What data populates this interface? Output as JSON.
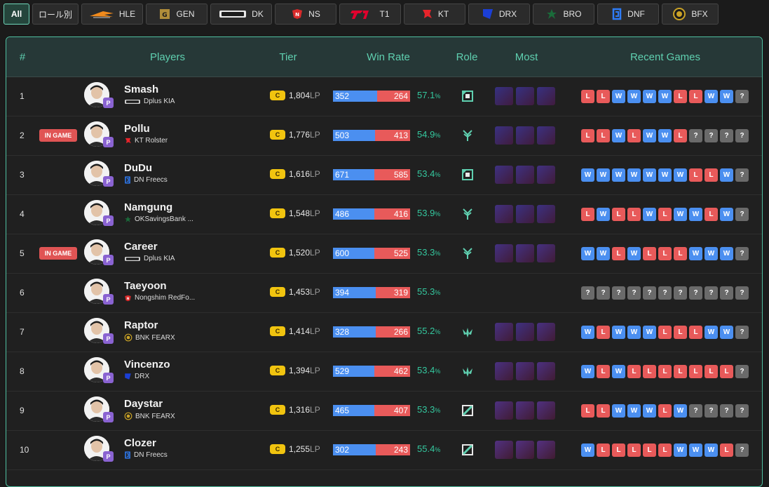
{
  "tabs": [
    {
      "label": "All",
      "logo": "",
      "active": true
    },
    {
      "label": "ロール別",
      "logo": "",
      "active": false
    },
    {
      "label": "HLE",
      "logo": "hle-logo",
      "active": false
    },
    {
      "label": "GEN",
      "logo": "gen-logo",
      "active": false
    },
    {
      "label": "DK",
      "logo": "dk-logo",
      "active": false
    },
    {
      "label": "NS",
      "logo": "ns-logo",
      "active": false
    },
    {
      "label": "T1",
      "logo": "t1-logo",
      "active": false
    },
    {
      "label": "KT",
      "logo": "kt-logo",
      "active": false
    },
    {
      "label": "DRX",
      "logo": "drx-logo",
      "active": false
    },
    {
      "label": "BRO",
      "logo": "bro-logo",
      "active": false
    },
    {
      "label": "DNF",
      "logo": "dnf-logo",
      "active": false
    },
    {
      "label": "BFX",
      "logo": "bfx-logo",
      "active": false
    }
  ],
  "headers": {
    "rank": "#",
    "players": "Players",
    "tier": "Tier",
    "win_rate": "Win Rate",
    "role": "Role",
    "most": "Most",
    "recent": "Recent Games"
  },
  "labels": {
    "in_game": "IN GAME",
    "position_badge": "P",
    "tier_badge": "C",
    "lp_unit": "LP",
    "pct_unit": "%"
  },
  "colors": {
    "accent": "#5fd0b0",
    "win": "#4b8ff0",
    "loss": "#e85a5a",
    "unknown": "#6a6a6a",
    "in_game": "#e05454",
    "tier_badge": "#f1c40f",
    "pct_text": "#34c79e"
  },
  "players": [
    {
      "rank": "1",
      "in_game": false,
      "name": "Smash",
      "team": "Dplus KIA",
      "team_logo": "dk-logo",
      "lp": "1,804",
      "wins": 352,
      "losses": 264,
      "win_rate": "57.1",
      "role": "top",
      "most": [
        "champ-a",
        "champ-b",
        "champ-c"
      ],
      "recent": [
        "L",
        "L",
        "W",
        "W",
        "W",
        "W",
        "L",
        "L",
        "W",
        "W",
        "?"
      ]
    },
    {
      "rank": "2",
      "in_game": true,
      "name": "Pollu",
      "team": "KT Rolster",
      "team_logo": "kt-logo",
      "lp": "1,776",
      "wins": 503,
      "losses": 413,
      "win_rate": "54.9",
      "role": "jungle",
      "most": [
        "champ-d",
        "champ-e",
        "champ-f"
      ],
      "recent": [
        "L",
        "L",
        "W",
        "L",
        "W",
        "W",
        "L",
        "?",
        "?",
        "?",
        "?"
      ]
    },
    {
      "rank": "3",
      "in_game": false,
      "name": "DuDu",
      "team": "DN Freecs",
      "team_logo": "dnf-logo",
      "lp": "1,616",
      "wins": 671,
      "losses": 585,
      "win_rate": "53.4",
      "role": "top",
      "most": [
        "champ-g",
        "champ-h",
        "champ-i"
      ],
      "recent": [
        "W",
        "W",
        "W",
        "W",
        "W",
        "W",
        "W",
        "L",
        "L",
        "W",
        "?"
      ]
    },
    {
      "rank": "4",
      "in_game": false,
      "name": "Namgung",
      "team": "OKSavingsBank ...",
      "team_logo": "bro-logo",
      "lp": "1,548",
      "wins": 486,
      "losses": 416,
      "win_rate": "53.9",
      "role": "jungle",
      "most": [
        "champ-j",
        "champ-e",
        "champ-f"
      ],
      "recent": [
        "L",
        "W",
        "L",
        "L",
        "W",
        "L",
        "W",
        "W",
        "L",
        "W",
        "?"
      ]
    },
    {
      "rank": "5",
      "in_game": true,
      "name": "Career",
      "team": "Dplus KIA",
      "team_logo": "dk-logo",
      "lp": "1,520",
      "wins": 600,
      "losses": 525,
      "win_rate": "53.3",
      "role": "jungle",
      "most": [
        "champ-k",
        "champ-l",
        "champ-m"
      ],
      "recent": [
        "W",
        "W",
        "L",
        "W",
        "L",
        "L",
        "L",
        "W",
        "W",
        "W",
        "?"
      ]
    },
    {
      "rank": "6",
      "in_game": false,
      "name": "Taeyoon",
      "team": "Nongshim RedFo...",
      "team_logo": "ns-logo",
      "lp": "1,453",
      "wins": 394,
      "losses": 319,
      "win_rate": "55.3",
      "role": "",
      "most": [],
      "recent": [
        "?",
        "?",
        "?",
        "?",
        "?",
        "?",
        "?",
        "?",
        "?",
        "?",
        "?"
      ]
    },
    {
      "rank": "7",
      "in_game": false,
      "name": "Raptor",
      "team": "BNK FEARX",
      "team_logo": "bfx-logo",
      "lp": "1,414",
      "wins": 328,
      "losses": 266,
      "win_rate": "55.2",
      "role": "support",
      "most": [
        "champ-n",
        "champ-h",
        "champ-o"
      ],
      "recent": [
        "W",
        "L",
        "W",
        "W",
        "W",
        "L",
        "L",
        "L",
        "W",
        "W",
        "?"
      ]
    },
    {
      "rank": "8",
      "in_game": false,
      "name": "Vincenzo",
      "team": "DRX",
      "team_logo": "drx-logo",
      "lp": "1,394",
      "wins": 529,
      "losses": 462,
      "win_rate": "53.4",
      "role": "support",
      "most": [
        "champ-p",
        "champ-q",
        "champ-r"
      ],
      "recent": [
        "W",
        "L",
        "W",
        "L",
        "L",
        "L",
        "L",
        "L",
        "L",
        "L",
        "?"
      ]
    },
    {
      "rank": "9",
      "in_game": false,
      "name": "Daystar",
      "team": "BNK FEARX",
      "team_logo": "bfx-logo",
      "lp": "1,316",
      "wins": 465,
      "losses": 407,
      "win_rate": "53.3",
      "role": "mid",
      "most": [
        "champ-s",
        "champ-t",
        "champ-u"
      ],
      "recent": [
        "L",
        "L",
        "W",
        "W",
        "W",
        "L",
        "W",
        "?",
        "?",
        "?",
        "?"
      ]
    },
    {
      "rank": "10",
      "in_game": false,
      "name": "Clozer",
      "team": "DN Freecs",
      "team_logo": "dnf-logo",
      "lp": "1,255",
      "wins": 302,
      "losses": 243,
      "win_rate": "55.4",
      "role": "mid",
      "most": [
        "champ-v",
        "champ-w",
        "champ-x"
      ],
      "recent": [
        "W",
        "L",
        "L",
        "L",
        "L",
        "L",
        "W",
        "W",
        "W",
        "L",
        "?"
      ]
    }
  ]
}
